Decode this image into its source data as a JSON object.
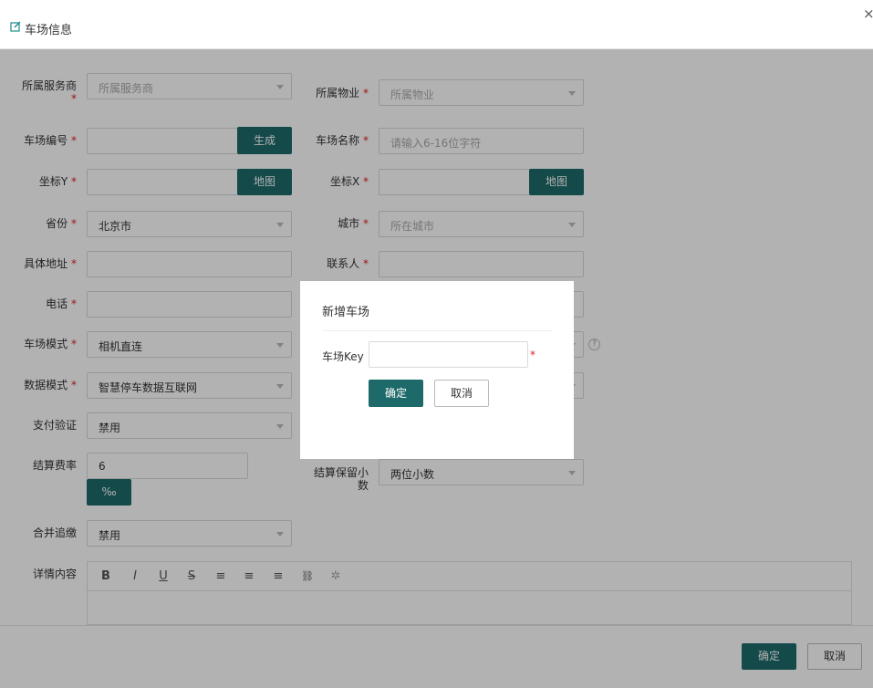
{
  "header": {
    "title": "车场信息",
    "close": "×"
  },
  "form": {
    "provider": {
      "label": "所属服务商",
      "placeholder": "所属服务商"
    },
    "property": {
      "label": "所属物业",
      "placeholder": "所属物业"
    },
    "lot_code": {
      "label": "车场编号",
      "value": "",
      "button": "生成"
    },
    "lot_name": {
      "label": "车场名称",
      "placeholder": "请输入6-16位字符"
    },
    "coord_y": {
      "label": "坐标Y",
      "value": "",
      "button": "地图"
    },
    "coord_x": {
      "label": "坐标X",
      "value": "",
      "button": "地图"
    },
    "province": {
      "label": "省份",
      "value": "北京市"
    },
    "city": {
      "label": "城市",
      "placeholder": "所在城市"
    },
    "address": {
      "label": "具体地址",
      "value": ""
    },
    "contact": {
      "label": "联系人",
      "value": ""
    },
    "phone": {
      "label": "电话",
      "value": ""
    },
    "lot_mode": {
      "label": "车场模式",
      "value": "相机直连"
    },
    "data_mode": {
      "label": "数据模式",
      "value": "智慧停车数据互联网"
    },
    "pay_verify": {
      "label": "支付验证",
      "value": "禁用"
    },
    "settle_rate": {
      "label": "结算费率",
      "value": "6",
      "unit": "‰"
    },
    "settle_decimal": {
      "label_line1": "结算保留小",
      "label_line2": "数",
      "value": "两位小数"
    },
    "merge_pay": {
      "label": "合并追缴",
      "value": "禁用"
    },
    "details": {
      "label": "详情内容"
    },
    "required_mark": "*",
    "help_mark": "?"
  },
  "editor_toolbar": [
    {
      "name": "bold-icon",
      "glyph": "B"
    },
    {
      "name": "italic-icon",
      "glyph": "I"
    },
    {
      "name": "underline-icon",
      "glyph": "U"
    },
    {
      "name": "strikethrough-icon",
      "glyph": "S"
    },
    {
      "name": "align-left-icon",
      "glyph": "≡"
    },
    {
      "name": "align-center-icon",
      "glyph": "≡"
    },
    {
      "name": "align-right-icon",
      "glyph": "≡"
    },
    {
      "name": "link-icon",
      "glyph": "🔗"
    },
    {
      "name": "unlink-icon",
      "glyph": "✲"
    }
  ],
  "footer": {
    "ok": "确定",
    "cancel": "取消"
  },
  "dialog": {
    "title": "新增车场",
    "field_label": "车场Key",
    "field_value": "",
    "required_mark": "*",
    "ok": "确定",
    "cancel": "取消"
  },
  "colors": {
    "primary": "#1e6a6a",
    "required": "#e02020",
    "overlay": "rgba(0,0,0,0.3)"
  }
}
